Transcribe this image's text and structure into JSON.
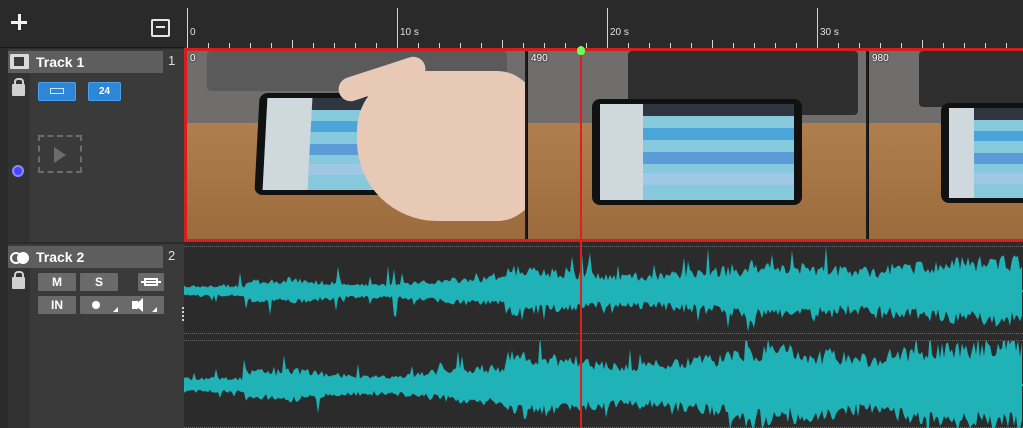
{
  "toolbar": {
    "add_icon": "plus-icon",
    "collapse_icon": "panel-collapse-icon"
  },
  "ruler": {
    "labels": [
      "0",
      "10 s",
      "20 s",
      "30 s"
    ]
  },
  "track1": {
    "name": "Track 1",
    "number": "1",
    "type_icon": "film-icon",
    "lock_icon": "lock-icon",
    "button2_label": "24",
    "frames": [
      {
        "label": "0"
      },
      {
        "label": "490"
      },
      {
        "label": "980"
      }
    ]
  },
  "track2": {
    "name": "Track 2",
    "number": "2",
    "type_icon": "stereo-icon",
    "lock_icon": "lock-icon",
    "mute_label": "M",
    "solo_label": "S",
    "input_label": "IN"
  },
  "colors": {
    "clip_border": "#d91c1c",
    "waveform": "#1fb3b8",
    "playhead": "#e21d1d",
    "playhead_knob": "#6bff58",
    "accent_button": "#2e86d6"
  }
}
